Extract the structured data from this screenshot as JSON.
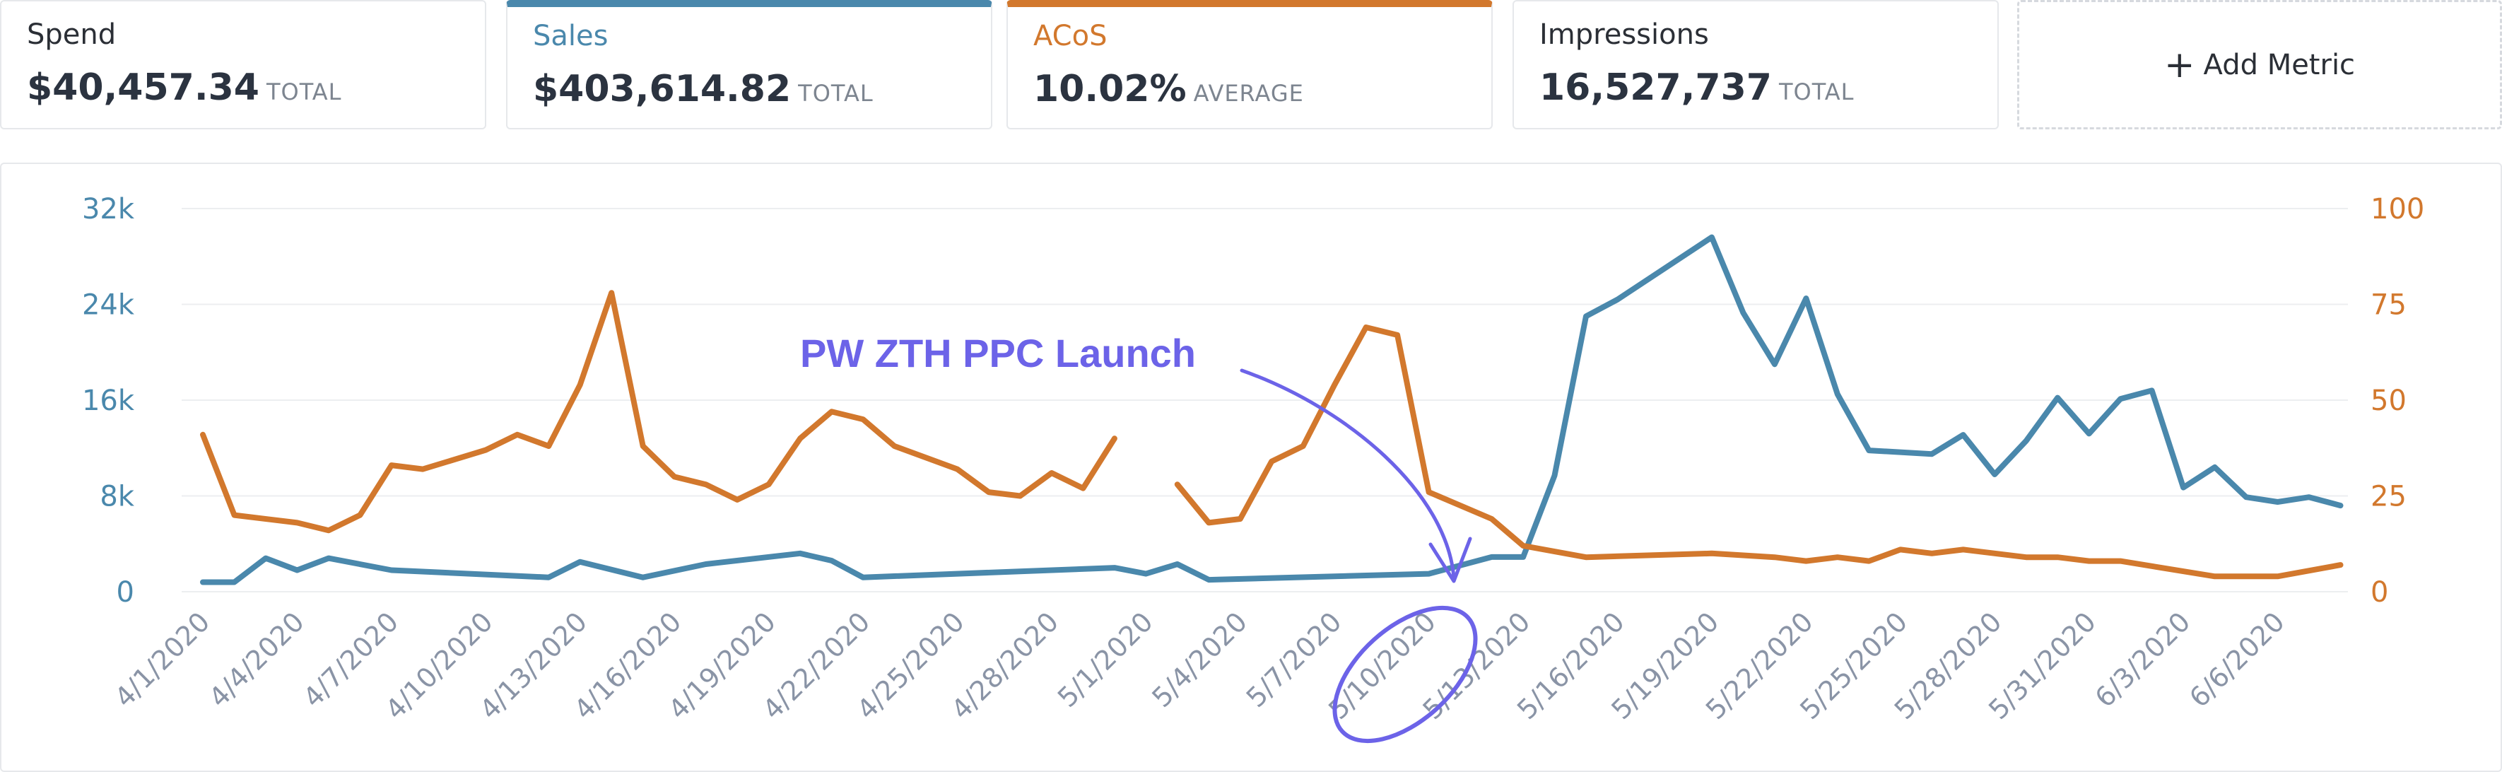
{
  "metrics": [
    {
      "label": "Spend",
      "value": "$40,457.34",
      "suffix": "TOTAL",
      "selected": false,
      "color": "#2b2f36"
    },
    {
      "label": "Sales",
      "value": "$403,614.82",
      "suffix": "TOTAL",
      "selected": true,
      "color": "#4a88ac"
    },
    {
      "label": "ACoS",
      "value": "10.02%",
      "suffix": "AVERAGE",
      "selected": true,
      "color": "#d2782d"
    },
    {
      "label": "Impressions",
      "value": "16,527,737",
      "suffix": "TOTAL",
      "selected": false,
      "color": "#2b2f36"
    }
  ],
  "add_metric": {
    "plus": "+",
    "label": "Add Metric"
  },
  "colors": {
    "sales": "#4a88ac",
    "acos": "#d2782d",
    "annotation": "#6c63e8",
    "grid": "#eceef0",
    "card_border": "#e6e8eb"
  },
  "chart_data": {
    "type": "line",
    "grid": true,
    "legend": "none",
    "y_left": {
      "ticks": [
        "0",
        "8k",
        "16k",
        "24k",
        "32k"
      ],
      "range": [
        0,
        32000
      ]
    },
    "y_right": {
      "ticks": [
        "0",
        "25",
        "50",
        "75",
        "100"
      ],
      "range": [
        0,
        100
      ]
    },
    "x_labels": [
      "4/1/2020",
      "4/4/2020",
      "4/7/2020",
      "4/10/2020",
      "4/13/2020",
      "4/16/2020",
      "4/19/2020",
      "4/22/2020",
      "4/25/2020",
      "4/28/2020",
      "5/1/2020",
      "5/4/2020",
      "5/7/2020",
      "5/10/2020",
      "5/13/2020",
      "5/16/2020",
      "5/19/2020",
      "5/22/2020",
      "5/25/2020",
      "5/28/2020",
      "5/31/2020",
      "6/3/2020",
      "6/6/2020"
    ],
    "x_range": [
      "2020-04-01",
      "2020-06-07"
    ],
    "series": [
      {
        "axis": "left",
        "color": "#4a88ac",
        "points": [
          [
            "2020-04-01",
            800
          ],
          [
            "2020-04-02",
            800
          ],
          [
            "2020-04-03",
            2800
          ],
          [
            "2020-04-04",
            1800
          ],
          [
            "2020-04-05",
            2800
          ],
          [
            "2020-04-07",
            1800
          ],
          [
            "2020-04-12",
            1200
          ],
          [
            "2020-04-13",
            2500
          ],
          [
            "2020-04-15",
            1200
          ],
          [
            "2020-04-17",
            2300
          ],
          [
            "2020-04-20",
            3200
          ],
          [
            "2020-04-21",
            2600
          ],
          [
            "2020-04-22",
            1200
          ],
          [
            "2020-04-30",
            2000
          ],
          [
            "2020-05-01",
            1500
          ],
          [
            "2020-05-02",
            2300
          ],
          [
            "2020-05-03",
            1000
          ],
          [
            "2020-05-10",
            1500
          ],
          [
            "2020-05-12",
            2900
          ],
          [
            "2020-05-13",
            2900
          ],
          [
            "2020-05-14",
            9700
          ],
          [
            "2020-05-15",
            23000
          ],
          [
            "2020-05-16",
            24400
          ],
          [
            "2020-05-19",
            29600
          ],
          [
            "2020-05-20",
            23300
          ],
          [
            "2020-05-21",
            19000
          ],
          [
            "2020-05-22",
            24500
          ],
          [
            "2020-05-23",
            16500
          ],
          [
            "2020-05-24",
            11800
          ],
          [
            "2020-05-26",
            11500
          ],
          [
            "2020-05-27",
            13100
          ],
          [
            "2020-05-28",
            9800
          ],
          [
            "2020-05-29",
            12600
          ],
          [
            "2020-05-30",
            16200
          ],
          [
            "2020-05-31",
            13200
          ],
          [
            "2020-06-01",
            16100
          ],
          [
            "2020-06-02",
            16800
          ],
          [
            "2020-06-03",
            8700
          ],
          [
            "2020-06-04",
            10400
          ],
          [
            "2020-06-05",
            7900
          ],
          [
            "2020-06-06",
            7500
          ],
          [
            "2020-06-07",
            7900
          ],
          [
            "2020-06-08",
            7200
          ]
        ]
      },
      {
        "axis": "right",
        "color": "#d2782d",
        "segments": [
          [
            [
              "2020-04-01",
              41
            ],
            [
              "2020-04-02",
              20
            ],
            [
              "2020-04-04",
              18
            ],
            [
              "2020-04-05",
              16
            ],
            [
              "2020-04-06",
              20
            ],
            [
              "2020-04-07",
              33
            ],
            [
              "2020-04-08",
              32
            ],
            [
              "2020-04-10",
              37
            ],
            [
              "2020-04-11",
              41
            ],
            [
              "2020-04-12",
              38
            ],
            [
              "2020-04-13",
              54
            ],
            [
              "2020-04-14",
              78
            ],
            [
              "2020-04-15",
              38
            ],
            [
              "2020-04-16",
              30
            ],
            [
              "2020-04-17",
              28
            ],
            [
              "2020-04-18",
              24
            ],
            [
              "2020-04-19",
              28
            ],
            [
              "2020-04-20",
              40
            ],
            [
              "2020-04-21",
              47
            ],
            [
              "2020-04-22",
              45
            ],
            [
              "2020-04-23",
              38
            ],
            [
              "2020-04-25",
              32
            ],
            [
              "2020-04-26",
              26
            ],
            [
              "2020-04-27",
              25
            ],
            [
              "2020-04-28",
              31
            ],
            [
              "2020-04-29",
              27
            ],
            [
              "2020-04-30",
              40
            ]
          ],
          [
            [
              "2020-05-02",
              28
            ],
            [
              "2020-05-03",
              18
            ],
            [
              "2020-05-04",
              19
            ],
            [
              "2020-05-05",
              34
            ],
            [
              "2020-05-06",
              38
            ],
            [
              "2020-05-07",
              54
            ],
            [
              "2020-05-08",
              69
            ],
            [
              "2020-05-09",
              67
            ],
            [
              "2020-05-10",
              26
            ],
            [
              "2020-05-12",
              19
            ],
            [
              "2020-05-13",
              12
            ],
            [
              "2020-05-15",
              9
            ],
            [
              "2020-05-19",
              10
            ],
            [
              "2020-05-21",
              9
            ],
            [
              "2020-05-22",
              8
            ],
            [
              "2020-05-23",
              9
            ],
            [
              "2020-05-24",
              8
            ],
            [
              "2020-05-25",
              11
            ],
            [
              "2020-05-26",
              10
            ],
            [
              "2020-05-27",
              11
            ],
            [
              "2020-05-29",
              9
            ],
            [
              "2020-05-30",
              9
            ],
            [
              "2020-05-31",
              8
            ],
            [
              "2020-06-01",
              8
            ],
            [
              "2020-06-04",
              4
            ],
            [
              "2020-06-05",
              4
            ],
            [
              "2020-06-06",
              4
            ],
            [
              "2020-06-08",
              7
            ]
          ]
        ]
      }
    ],
    "annotation": {
      "text": "PW ZTH PPC Launch",
      "target": "5/10/2020"
    }
  }
}
